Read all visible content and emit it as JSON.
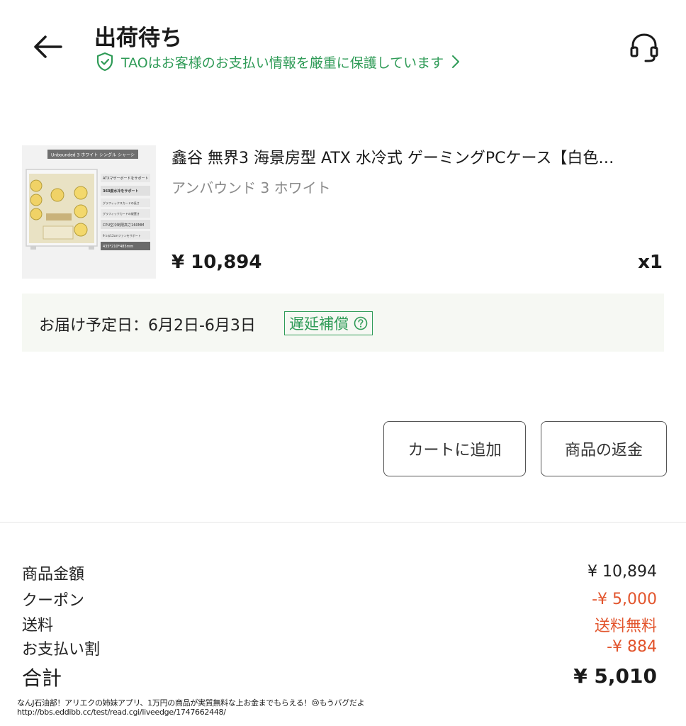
{
  "header": {
    "title": "出荷待ち",
    "security_text": "TAOはお客様のお支払い情報を厳重に保護しています",
    "accent_color": "#2f9b57"
  },
  "product": {
    "title": "鑫谷 無界3 海景房型 ATX 水冷式 ゲーミングPCケース【白色…",
    "variant": "アンバウンド 3 ホワイト",
    "price": "¥ 10,894",
    "quantity": "x1",
    "image": {
      "banner": "Unbounded 3 ホワイト シングル シャーシ",
      "features": [
        "ATXマザーボードをサポート",
        "360度水冷をサポート",
        "グラフィックスカードの長さ",
        "グラフィックカードの縦置き",
        "CPU空冷制限高さ160MM",
        "9つの12cmファンをサポート",
        "435*210*485mm"
      ]
    }
  },
  "delivery": {
    "text": "お届け予定日：6月2日-6月3日",
    "badge": "遅延補償"
  },
  "actions": {
    "add_to_cart": "カートに追加",
    "refund": "商品の返金"
  },
  "summary": {
    "rows": [
      {
        "label": "商品金額",
        "value": "¥ 10,894"
      },
      {
        "label": "クーポン",
        "value": "-¥ 5,000"
      },
      {
        "label": "送料",
        "value": "送料無料"
      },
      {
        "label": "お支払い割",
        "value": "-¥ 884"
      }
    ],
    "total_label": "合計",
    "total_value": "¥ 5,010",
    "discount_color": "#e2542c"
  },
  "watermark": {
    "line1": "なんJ石油部！アリエクの姉妹アプリ、1万円の商品が実質無料な上お金までもらえる！😢もうバグだよ",
    "line2": "http://bbs.eddibb.cc/test/read.cgi/liveedge/1747662448/"
  }
}
